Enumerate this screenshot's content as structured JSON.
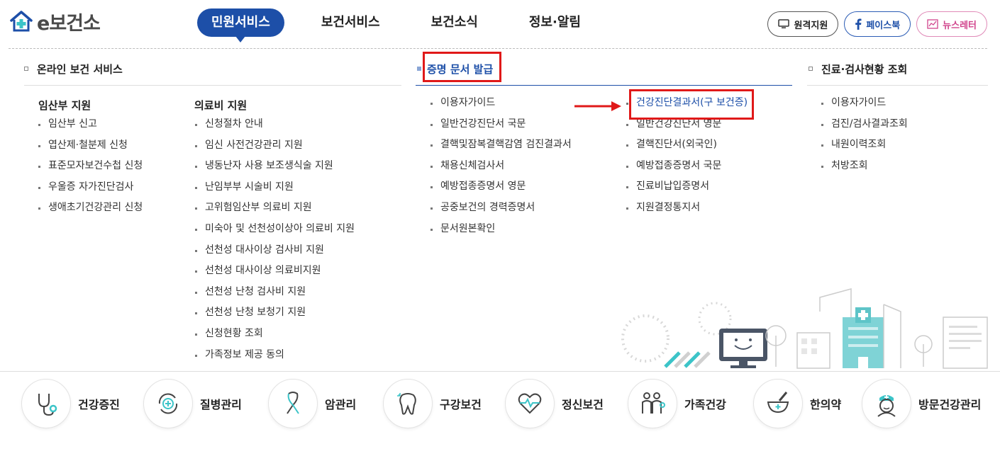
{
  "header": {
    "logo_text": "보건소",
    "logo_prefix": "e",
    "nav": [
      {
        "label": "민원서비스",
        "active": true
      },
      {
        "label": "보건서비스",
        "active": false
      },
      {
        "label": "보건소식",
        "active": false
      },
      {
        "label": "정보·알림",
        "active": false
      }
    ],
    "util": {
      "remote": "원격지원",
      "facebook": "페이스북",
      "newsletter": "뉴스레터"
    }
  },
  "sections": {
    "online": {
      "title": "온라인 보건 서비스",
      "groups": [
        {
          "title": "임산부 지원",
          "items": [
            "임산부 신고",
            "엽산제·철분제 신청",
            "표준모자보건수첩 신청",
            "우울증 자가진단검사",
            "생애초기건강관리 신청"
          ]
        },
        {
          "title": "의료비 지원",
          "items": [
            "신청절차 안내",
            "임신 사전건강관리 지원",
            "냉동난자 사용 보조생식술 지원",
            "난임부부 시술비 지원",
            "고위험임산부 의료비 지원",
            "미숙아 및 선천성이상아 의료비 지원",
            "선천성 대사이상 검사비 지원",
            "선천성 대사이상 의료비지원",
            "선천성 난청 검사비 지원",
            "선천성 난청 보청기 지원",
            "신청현황 조회",
            "가족정보 제공 동의"
          ]
        }
      ]
    },
    "certificate": {
      "title": "증명 문서 발급",
      "col1": [
        "이용자가이드",
        "일반건강진단서 국문",
        "결핵및잠복결핵감염 검진결과서",
        "채용신체검사서",
        "예방접종증명서 영문",
        "공중보건의 경력증명서",
        "문서원본확인"
      ],
      "col2": [
        "건강진단결과서(구 보건증)",
        "일반건강진단서 영문",
        "결핵진단서(외국인)",
        "예방접종증명서 국문",
        "진료비납입증명서",
        "지원결정통지서"
      ]
    },
    "clinic": {
      "title": "진료·검사현황 조회",
      "items": [
        "이용자가이드",
        "검진/검사결과조회",
        "내원이력조회",
        "처방조회"
      ]
    }
  },
  "quick_menu": [
    {
      "label": "건강증진",
      "icon": "stethoscope-icon"
    },
    {
      "label": "질병관리",
      "icon": "medical-cycle-icon"
    },
    {
      "label": "암관리",
      "icon": "ribbon-icon"
    },
    {
      "label": "구강보건",
      "icon": "tooth-icon"
    },
    {
      "label": "정신보건",
      "icon": "heart-pulse-icon"
    },
    {
      "label": "가족건강",
      "icon": "family-icon"
    },
    {
      "label": "한의약",
      "icon": "mortar-icon"
    },
    {
      "label": "방문건강관리",
      "icon": "nurse-icon"
    }
  ],
  "colors": {
    "brand_blue": "#1d4fa8",
    "accent_teal": "#3cc4c8",
    "highlight_red": "#e01919"
  }
}
